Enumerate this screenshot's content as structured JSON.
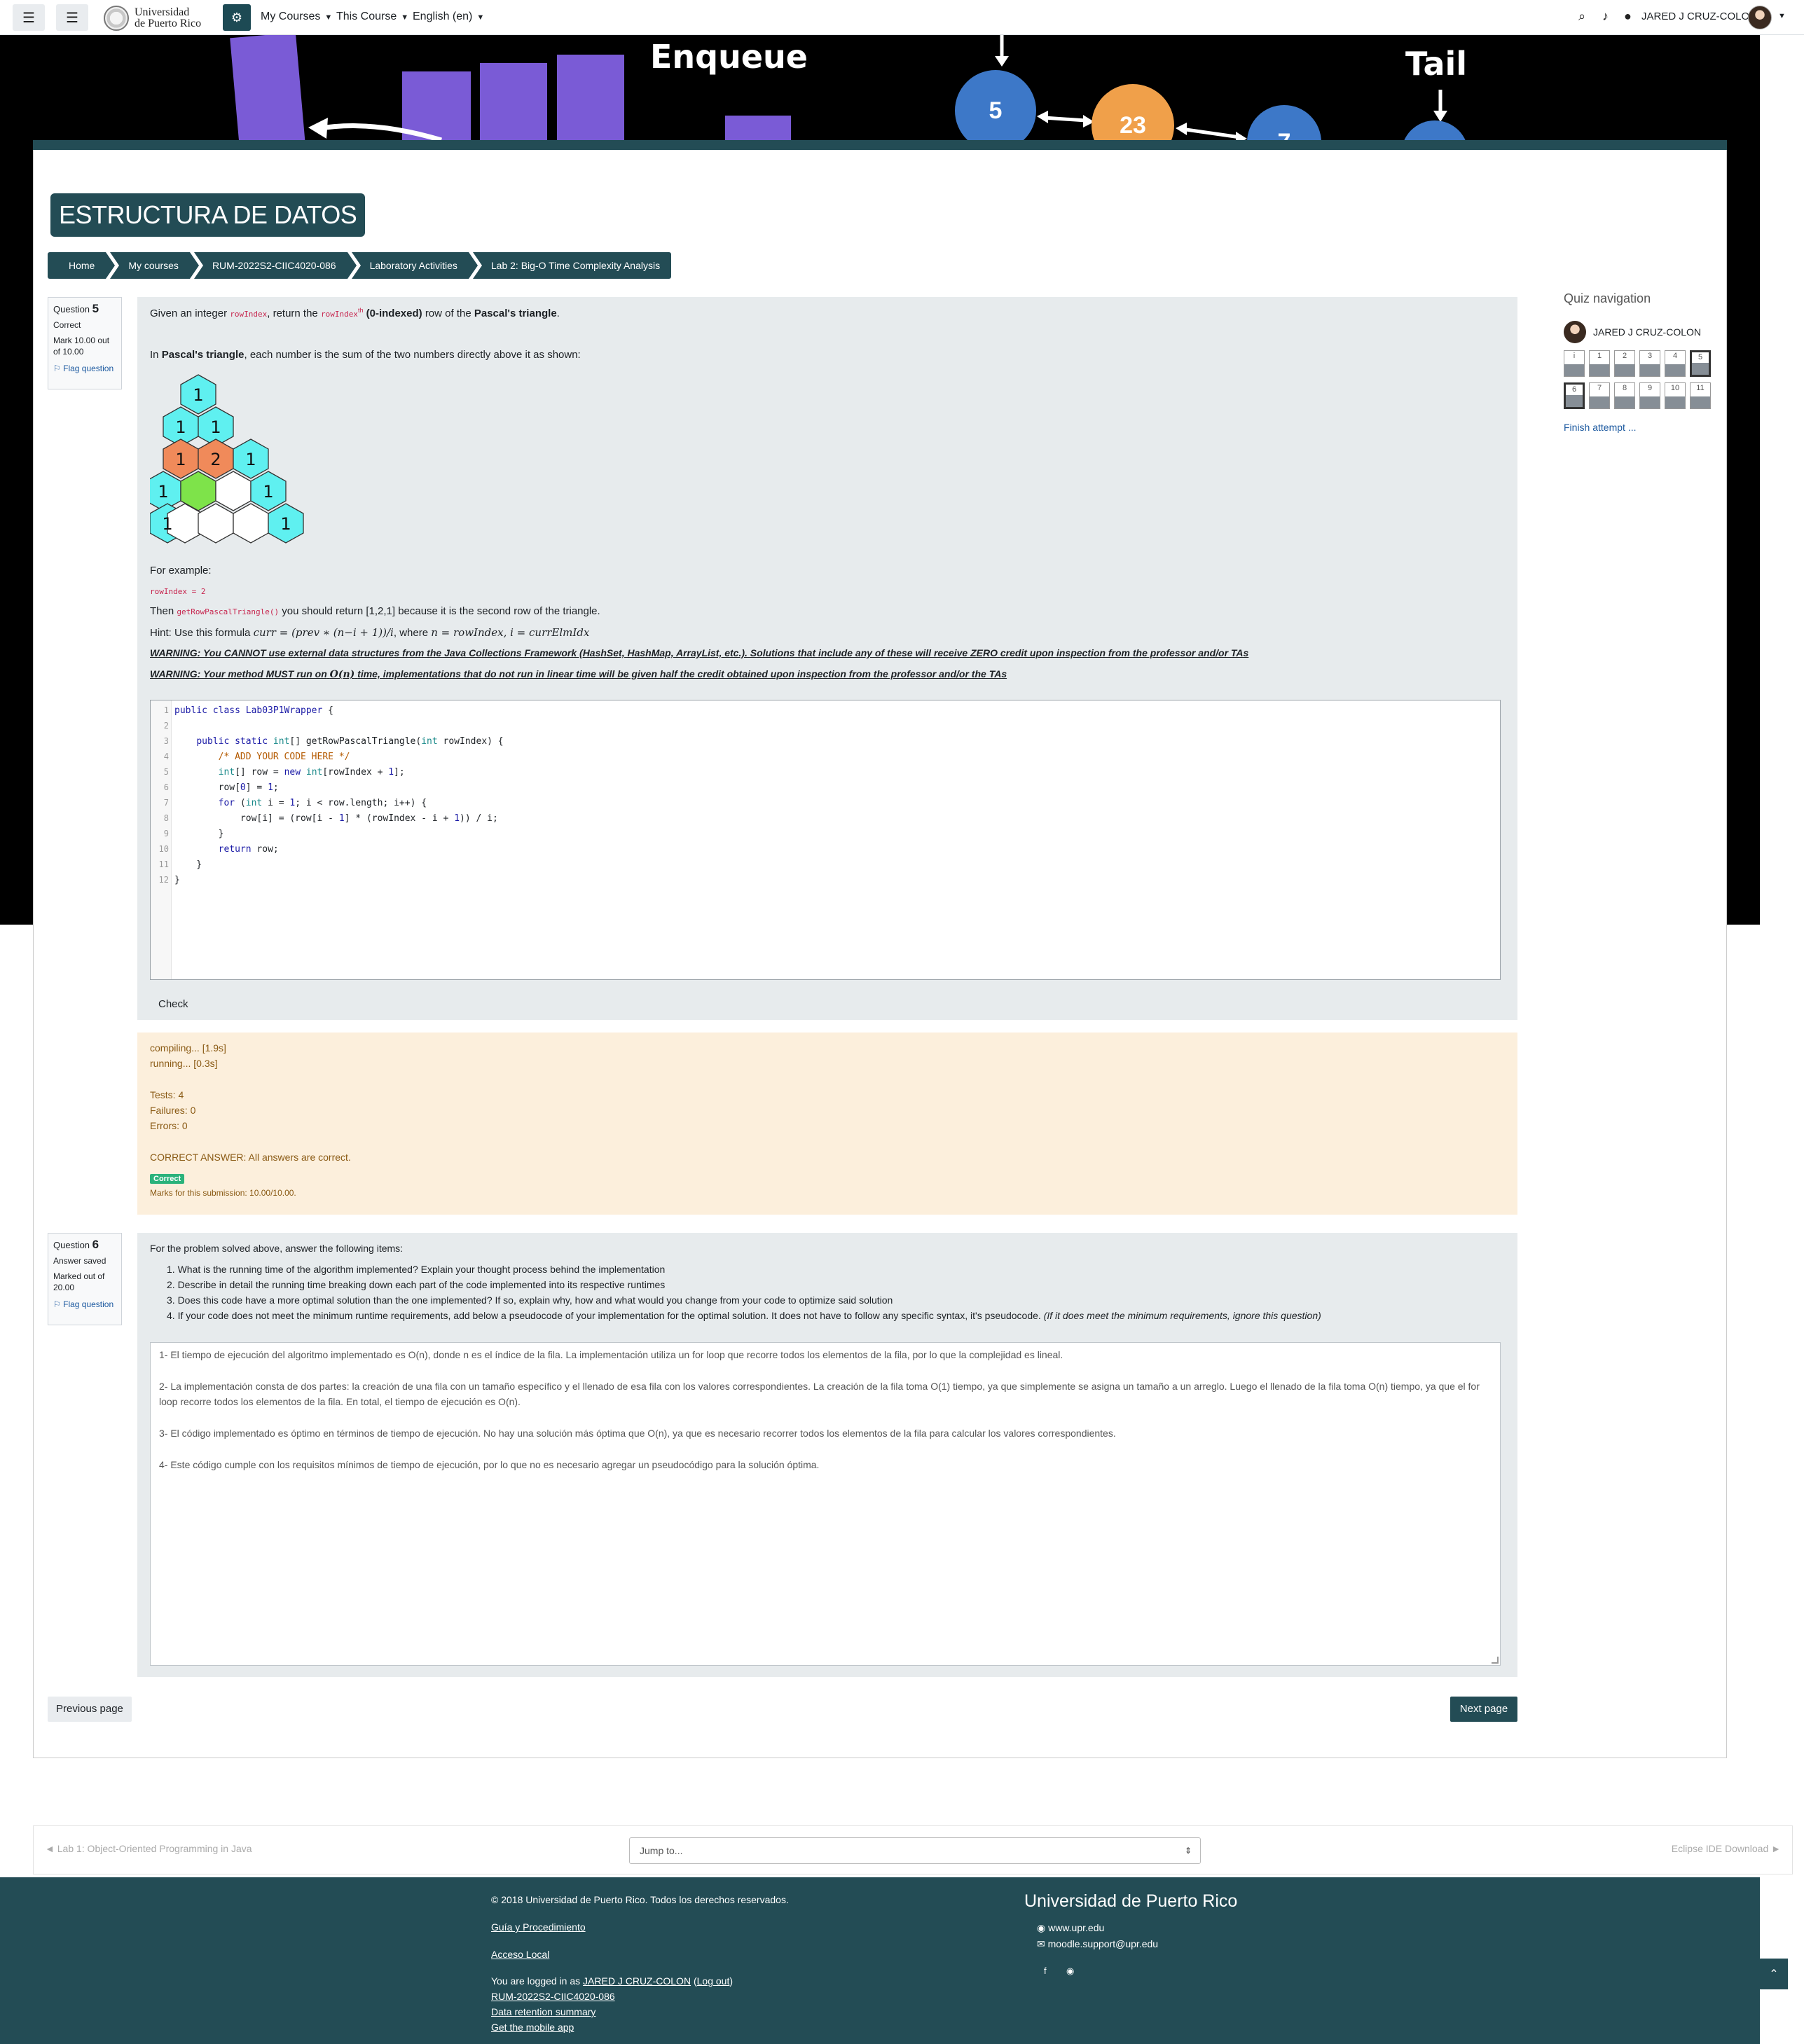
{
  "navbar": {
    "site_name_line1": "Universidad",
    "site_name_line2": "de Puerto Rico",
    "menu_my_courses": "My Courses",
    "menu_this_course": "This Course",
    "menu_language": "English (en)",
    "user_name": "JARED J CRUZ-COLON",
    "icons": [
      "hamburger-icon",
      "list-icon",
      "cogs-icon",
      "search-icon",
      "bell-icon",
      "chat-icon"
    ]
  },
  "banner": {
    "word_enqueue": "Enqueue",
    "word_tail": "Tail",
    "node_values": [
      "5",
      "23",
      "7"
    ],
    "colors": {
      "queue_block": "#7a5bd6",
      "node_blue": "#3d78c8",
      "node_orange": "#f0a04a"
    }
  },
  "course": {
    "title": "ESTRUCTURA DE DATOS",
    "breadcrumb": [
      "Home",
      "My courses",
      "RUM-2022S2-CIIC4020-086",
      "Laboratory Activities",
      "Lab 2: Big-O Time Complexity Analysis"
    ]
  },
  "q5": {
    "label": "Question",
    "number": "5",
    "state": "Correct",
    "mark": "Mark 10.00 out of 10.00",
    "flag": "Flag question",
    "text": {
      "p1_a": "Given an integer",
      "p1_code1": "rowIndex",
      "p1_b": ", return the",
      "p1_code2": "rowIndex",
      "p1_sup": "th",
      "p1_bold1": "(0-indexed)",
      "p1_c": "row of the",
      "p1_bold2": "Pascal's triangle",
      "p1_end": ".",
      "p2_bold": "Pascal's triangle",
      "p2_rest": ", each number is the sum of the two numbers directly above it as shown:",
      "p2_in": "In",
      "example_label": "For example:",
      "example_code": "rowIndex = 2",
      "then_a": "Then",
      "then_code": "getRowPascalTriangle()",
      "then_b": "you should return [1,2,1] because it is the second row of the triangle.",
      "hint_a": "Hint: Use this formula",
      "hint_formula": "curr = (prev ∗ (n−i + 1))/i",
      "hint_b": ", where",
      "hint_formula2": "n = rowIndex, i = currElmIdx",
      "warning1": "WARNING: You CANNOT use external data structures from the Java Collections Framework (HashSet, HashMap, ArrayList, etc.). Solutions that include any of these will receive ZERO credit upon inspection from the professor and/or TAs",
      "warning2_a": "WARNING: Your method MUST run on",
      "warning2_math": "O(n)",
      "warning2_b": "time, implementations that do not run in linear time will be given half the credit obtained upon inspection from the professor and/or the TAs"
    },
    "triangle_labels": [
      "1",
      "1",
      "1",
      "1",
      "2",
      "1",
      "1",
      "1",
      "1",
      "1"
    ],
    "code_lines": [
      "public class Lab03P1Wrapper {",
      "",
      "    public static int[] getRowPascalTriangle(int rowIndex) {",
      "        /* ADD YOUR CODE HERE */",
      "        int[] row = new int[rowIndex + 1];",
      "        row[0] = 1;",
      "        for (int i = 1; i < row.length; i++) {",
      "            row[i] = (row[i - 1] * (rowIndex - i + 1)) / i;",
      "        }",
      "        return row;",
      "    }",
      "}"
    ],
    "check_label": "Check",
    "feedback": {
      "compiling": "compiling... [1.9s]",
      "running": "running... [0.3s]",
      "tests": "Tests: 4",
      "failures": "Failures: 0",
      "errors": "Errors: 0",
      "correct_answer": "CORRECT ANSWER: All answers are correct.",
      "badge": "Correct",
      "marks": "Marks for this submission: 10.00/10.00."
    }
  },
  "q6": {
    "label": "Question",
    "number": "6",
    "state": "Answer saved",
    "mark": "Marked out of 20.00",
    "flag": "Flag question",
    "intro": "For the problem solved above, answer the following items:",
    "items": [
      "1. What is the running time of the algorithm implemented? Explain your thought process behind the implementation",
      "2. Describe in detail the running time breaking down each part of the code implemented into its respective runtimes",
      "3. Does this code have a more optimal solution than the one implemented? If so, explain why, how and what would you change from your code to optimize said solution",
      "4. If your code does not meet the minimum runtime requirements, add below a pseudocode of your implementation for the optimal solution. It does not have to follow any specific syntax, it's pseudocode."
    ],
    "item4_italic": "(If it does meet the minimum requirements, ignore this question)",
    "answer": [
      "1- El tiempo de ejecución del algoritmo implementado es O(n), donde n es el índice de la fila. La implementación utiliza un for loop que recorre todos los elementos de la fila, por lo que la complejidad es lineal.",
      "2- La implementación consta de dos partes: la creación de una fila con un tamaño específico y el llenado de esa fila con los valores correspondientes. La creación de la fila toma O(1) tiempo, ya que simplemente se asigna un tamaño a un arreglo. Luego el llenado de la fila toma O(n) tiempo, ya que el for loop recorre todos los elementos de la fila. En total, el tiempo de ejecución es O(n).",
      "3- El código implementado es óptimo en términos de tiempo de ejecución. No hay una solución más óptima que O(n), ya que es necesario recorrer todos los elementos de la fila para calcular los valores correspondientes.",
      "4- Este código cumple con los requisitos mínimos de tiempo de ejecución, por lo que no es necesario agregar un pseudocódigo para la solución óptima."
    ]
  },
  "quiz_nav": {
    "title": "Quiz navigation",
    "user": "JARED J CRUZ-COLON",
    "row1": [
      "i",
      "1",
      "2",
      "3",
      "4",
      "5"
    ],
    "row2": [
      "6",
      "7",
      "8",
      "9",
      "10",
      "11"
    ],
    "finish": "Finish attempt ..."
  },
  "page_nav": {
    "previous": "Previous page",
    "next": "Next page"
  },
  "activity_nav": {
    "prev": "◄ Lab 1: Object-Oriented Programming in Java",
    "jump": "Jump to...",
    "next": "Eclipse IDE Download ►"
  },
  "footer": {
    "copyright": "© 2018 Universidad de Puerto Rico. Todos los derechos reservados.",
    "link1": "Guía y Procedimiento",
    "link2": "Acceso Local",
    "logged_a": "You are logged in as",
    "logged_user": "JARED J CRUZ-COLON",
    "logout": "Log out",
    "course_link": "RUM-2022S2-CIIC4020-086",
    "retention": "Data retention summary",
    "mobile": "Get the mobile app",
    "brand": "Universidad de Puerto Rico",
    "web": "www.upr.edu",
    "email": "moodle.support@upr.edu"
  }
}
